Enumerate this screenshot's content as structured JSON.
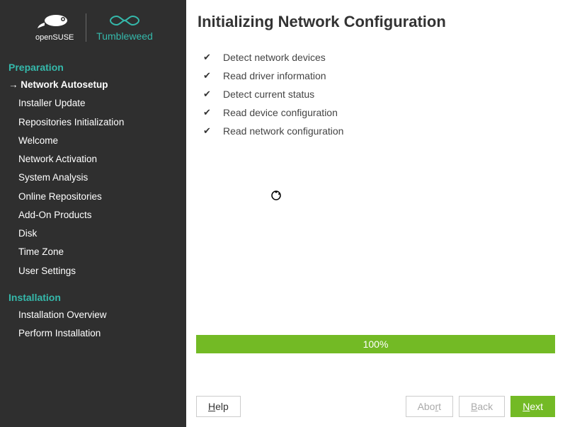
{
  "logo": {
    "brand": "openSUSE",
    "variant": "Tumbleweed"
  },
  "sidebar": {
    "sections": [
      {
        "title": "Preparation",
        "items": [
          {
            "label": "Network Autosetup",
            "active": true
          },
          {
            "label": "Installer Update",
            "active": false
          },
          {
            "label": "Repositories Initialization",
            "active": false
          },
          {
            "label": "Welcome",
            "active": false
          },
          {
            "label": "Network Activation",
            "active": false
          },
          {
            "label": "System Analysis",
            "active": false
          },
          {
            "label": "Online Repositories",
            "active": false
          },
          {
            "label": "Add-On Products",
            "active": false
          },
          {
            "label": "Disk",
            "active": false
          },
          {
            "label": "Time Zone",
            "active": false
          },
          {
            "label": "User Settings",
            "active": false
          }
        ]
      },
      {
        "title": "Installation",
        "items": [
          {
            "label": "Installation Overview",
            "active": false
          },
          {
            "label": "Perform Installation",
            "active": false
          }
        ]
      }
    ]
  },
  "header": {
    "title": "Initializing Network Configuration"
  },
  "steps": [
    {
      "check": "✔",
      "label": "Detect network devices"
    },
    {
      "check": "✔",
      "label": "Read driver information"
    },
    {
      "check": "✔",
      "label": "Detect current status"
    },
    {
      "check": "✔",
      "label": "Read device configuration"
    },
    {
      "check": "✔",
      "label": "Read network configuration"
    }
  ],
  "progress": {
    "percent_label": "100%"
  },
  "footer": {
    "help_u": "H",
    "help_rest": "elp",
    "abort_pre": "Abo",
    "abort_u": "r",
    "abort_post": "t",
    "back_u": "B",
    "back_rest": "ack",
    "next_u": "N",
    "next_rest": "ext"
  }
}
